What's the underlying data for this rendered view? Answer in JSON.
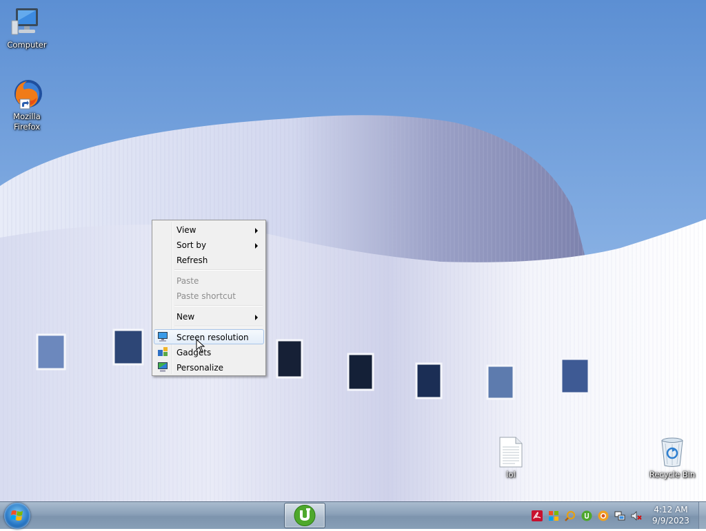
{
  "desktop": {
    "icons": [
      {
        "label": "Computer"
      },
      {
        "label": "Mozilla Firefox"
      },
      {
        "label": "lol"
      },
      {
        "label": "Recycle Bin"
      }
    ]
  },
  "context_menu": {
    "items": [
      {
        "label": "View",
        "submenu": true
      },
      {
        "label": "Sort by",
        "submenu": true
      },
      {
        "label": "Refresh"
      },
      {
        "label": "Paste",
        "disabled": true
      },
      {
        "label": "Paste shortcut",
        "disabled": true
      },
      {
        "label": "New",
        "submenu": true
      },
      {
        "label": "Screen resolution",
        "highlighted": true,
        "icon": "monitor-icon"
      },
      {
        "label": "Gadgets",
        "icon": "gadgets-icon"
      },
      {
        "label": "Personalize",
        "icon": "personalize-icon"
      }
    ]
  },
  "taskbar": {
    "pinned": [
      {
        "icon": "utorrent-icon"
      }
    ],
    "tray_icons": [
      "acrobat-icon",
      "windows-flag-icon",
      "search-magnifier-icon",
      "utorrent-tray-icon",
      "update-icon",
      "network-icon",
      "volume-muted-icon"
    ],
    "clock": {
      "time": "4:12 AM",
      "date": "9/9/2023"
    }
  },
  "colors": {
    "sky": "#6f9fd8",
    "menu_bg": "#f0f0f0",
    "menu_highlight_border": "#a8c4e8",
    "taskbar": "#8aa0b8"
  }
}
